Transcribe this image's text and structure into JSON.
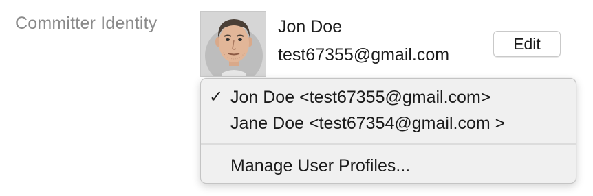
{
  "section": {
    "label": "Committer Identity"
  },
  "identity": {
    "name": "Jon Doe",
    "email": "test67355@gmail.com",
    "avatar_icon": "cartoon-face-avatar"
  },
  "edit_button": {
    "label": "Edit"
  },
  "menu": {
    "items": [
      {
        "label": "Jon Doe <test67355@gmail.com>",
        "checked": true,
        "check_glyph": "✓"
      },
      {
        "label": "Jane Doe <test67354@gmail.com >",
        "checked": false,
        "check_glyph": ""
      }
    ],
    "manage_label": "Manage User Profiles..."
  },
  "colors": {
    "label_gray": "#8a8a8a",
    "text": "#1b1b1b",
    "menu_bg": "#f0f0f0"
  }
}
